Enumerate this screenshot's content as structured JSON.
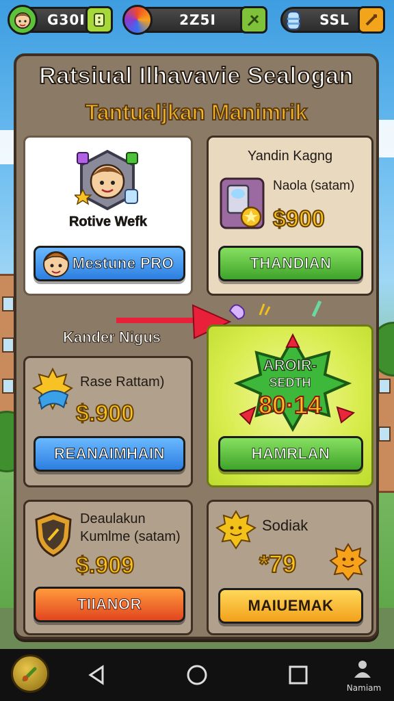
{
  "topbar": {
    "coins_value": "G30I",
    "gems_value": "2Z5I",
    "energy_value": "SSL"
  },
  "panel": {
    "title": "Ratsiual Ilhavavie Sealogan",
    "subtitle": "Tantualjkan Manimrik"
  },
  "offers": {
    "profile_card": {
      "caption": "Rotive Wefk",
      "button_label": "Mestune PRO"
    },
    "pack_card": {
      "heading": "Yandin Kagng",
      "caption": "Naola (satam)",
      "price": "$900",
      "button_label": "THANDIAN"
    },
    "section_label": "Kander Nigus",
    "raise_card": {
      "caption": "Rase Rattam)",
      "price": "$.900",
      "button_label": "REANAIMHAIN"
    },
    "featured_card": {
      "badge_line1": "AROIR-",
      "badge_line2": "SEDTH",
      "badge_value": "80·14",
      "button_label": "HAMRLAN"
    },
    "shield_card": {
      "caption_line1": "Deaulakun",
      "caption_line2": "Kumlme (satam)",
      "price": "$.909",
      "button_label": "TIIANOR"
    },
    "sun_card": {
      "heading": "Sodiak",
      "price": "*79",
      "button_label": "MAIUEMAK"
    }
  },
  "navbar": {
    "label": "Namiam"
  },
  "colors": {
    "panel_bg": "#8b7a66",
    "accent_gold": "#f7c324",
    "button_blue": "#2c7fe0",
    "button_green": "#3fa32a",
    "button_orange": "#e2461f",
    "featured_lime": "#d8ec4c"
  }
}
